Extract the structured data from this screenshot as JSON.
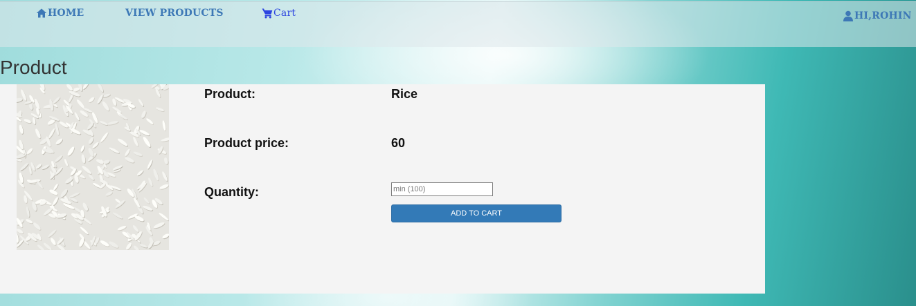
{
  "nav": {
    "home_label": "HOME",
    "view_products_label": "VIEW PRODUCTS",
    "cart_label": "Cart",
    "user_label": "HI,ROHIN",
    "icons": {
      "home": "home-icon",
      "cart": "shopping-cart-icon",
      "user": "user-icon"
    },
    "colors": {
      "link": "#3d78b6",
      "cart_link": "#2d45e0"
    }
  },
  "page": {
    "title": "Product"
  },
  "product": {
    "image": "rice-image",
    "name_label": "Product:",
    "name_value": "Rice",
    "price_label": "Product price:",
    "price_value": "60",
    "quantity_label": "Quantity:",
    "quantity_placeholder": "min (100)",
    "quantity_value": "",
    "add_to_cart_label": "ADD TO CART"
  },
  "colors": {
    "panel_background": "#f4f4f4",
    "button_background": "#337ab7",
    "button_text": "#ffffff"
  }
}
